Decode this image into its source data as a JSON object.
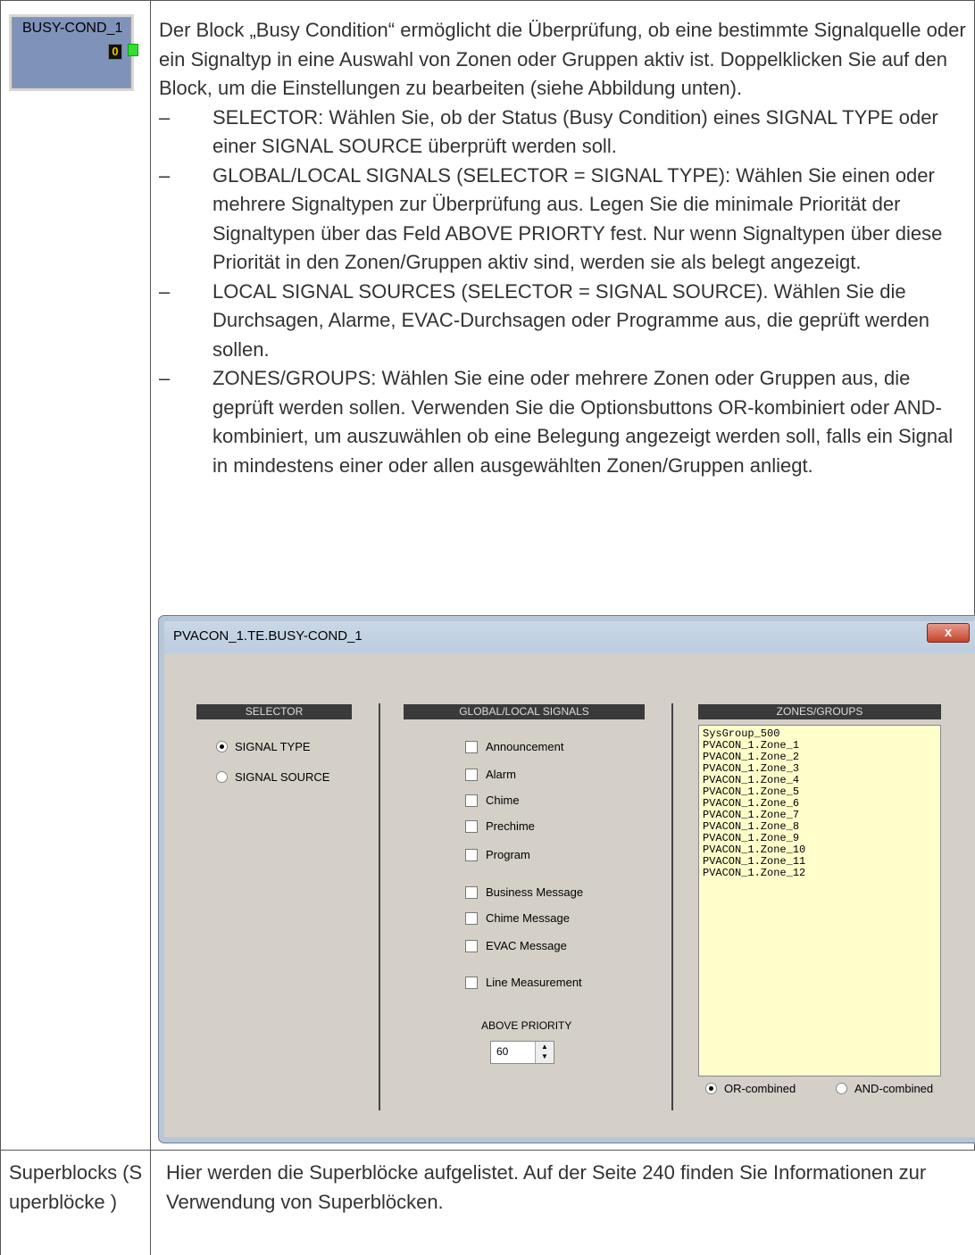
{
  "block": {
    "name": "BUSY-COND_1",
    "value": "0"
  },
  "description": {
    "intro": "Der Block „Busy Condition“ ermöglicht die Überprüfung, ob eine bestimmte Signalquelle oder ein Signaltyp in eine Auswahl von Zonen oder Gruppen aktiv ist. Doppelklicken Sie auf den Block, um die Einstellungen zu bearbeiten (siehe Abbildung unten).",
    "dash": "–",
    "bullets": [
      "SELECTOR: Wählen Sie, ob der Status (Busy Condition) eines SIGNAL TYPE oder einer SIGNAL SOURCE überprüft werden soll.",
      "GLOBAL/LOCAL SIGNALS (SELECTOR = SIGNAL TYPE): Wählen Sie einen oder mehrere Signaltypen zur Überprüfung aus. Legen Sie die minimale Priorität der Signaltypen über das Feld ABOVE PRIORTY fest. Nur wenn Signaltypen über diese Priorität in den Zonen/Gruppen aktiv sind, werden sie als belegt angezeigt.",
      "LOCAL SIGNAL SOURCES (SELECTOR = SIGNAL SOURCE). Wählen Sie die Durchsagen, Alarme, EVAC-Durchsagen oder Programme aus, die geprüft werden sollen.",
      "ZONES/GROUPS: Wählen Sie eine oder mehrere Zonen oder Gruppen aus, die geprüft werden sollen. Verwenden Sie die Optionsbuttons OR-kombiniert oder AND-kombiniert, um auszuwählen ob eine Belegung angezeigt werden soll, falls ein Signal in mindestens einer oder allen ausgewählten Zonen/Gruppen anliegt."
    ]
  },
  "dialog": {
    "title": "PVACON_1.TE.BUSY-COND_1",
    "close": "x",
    "selector": {
      "header": "SELECTOR",
      "options": [
        "SIGNAL TYPE",
        "SIGNAL SOURCE"
      ],
      "selected": "SIGNAL TYPE"
    },
    "signals": {
      "header": "GLOBAL/LOCAL SIGNALS",
      "items": [
        "Announcement",
        "Alarm",
        "Chime",
        "Prechime",
        "Program",
        "Business Message",
        "Chime Message",
        "EVAC Message",
        "Line Measurement"
      ],
      "priority_label": "ABOVE PRIORITY",
      "priority_value": "60"
    },
    "zones": {
      "header": "ZONES/GROUPS",
      "items": [
        "SysGroup_500",
        "PVACON_1.Zone_1",
        "PVACON_1.Zone_2",
        "PVACON_1.Zone_3",
        "PVACON_1.Zone_4",
        "PVACON_1.Zone_5",
        "PVACON_1.Zone_6",
        "PVACON_1.Zone_7",
        "PVACON_1.Zone_8",
        "PVACON_1.Zone_9",
        "PVACON_1.Zone_10",
        "PVACON_1.Zone_11",
        "PVACON_1.Zone_12"
      ],
      "combine_options": [
        "OR-combined",
        "AND-combined"
      ],
      "combine_selected": "OR-combined"
    }
  },
  "superblocks": {
    "label": "Superblocks (Superblöcke )",
    "text": "Hier werden die Superblöcke aufgelistet. Auf der Seite 240 finden Sie Informationen zur Verwendung von Superblöcken."
  }
}
